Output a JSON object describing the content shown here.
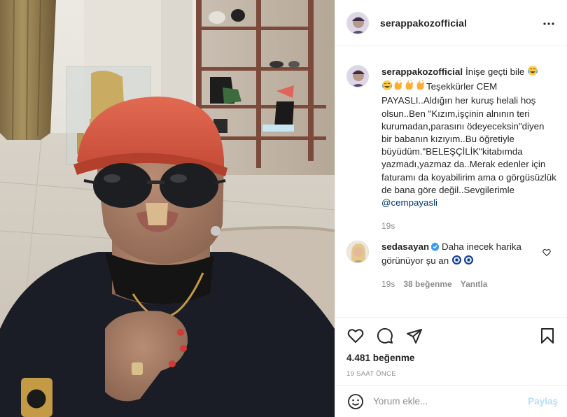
{
  "post": {
    "image_alt": "Selfie photo",
    "author": "serappakozofficial"
  },
  "header": {
    "username": "serappakozofficial",
    "more_icon": "more-horizontal-icon"
  },
  "caption": {
    "username": "serappakozofficial",
    "text_start": "İnişe geçti bile",
    "text_body": "Teşekkürler CEM PAYASLI..Aldığın her kuruş helali hoş olsun..Ben \"Kızım,işçinin alnının teri kurumadan,parasını ödeyeceksin\"diyen bir babanın kızıyım..Bu öğretiyle büyüdüm.\"BELEŞÇİLİK\"kitabımda yazmadı,yazmaz da..Merak edenler için faturamı da koyabilirim ama o görgüsüzlük de bana göre değil..Sevgilerimle",
    "mention": "@cempayasli",
    "time": "19s",
    "emojis": [
      "laughing-tears-emoji",
      "laughing-tears-emoji",
      "clapping-hands-emoji",
      "clapping-hands-emoji",
      "clapping-hands-emoji"
    ]
  },
  "reply": {
    "username": "sedasayan",
    "verified": true,
    "text": "Daha inecek harika görünüyor şu an",
    "emojis": [
      "evil-eye-emoji",
      "evil-eye-emoji"
    ],
    "time": "19s",
    "likes": "38 beğenme",
    "reply_label": "Yanıtla"
  },
  "actions": {
    "likes": "4.481 beğenme",
    "time_ago": "19 SAAT ÖNCE"
  },
  "comment_box": {
    "placeholder": "Yorum ekle...",
    "post_label": "Paylaş"
  },
  "colors": {
    "mention": "#00376b",
    "muted": "#8e8e8e",
    "post_disabled": "#b2dffc",
    "verified": "#3897f0"
  }
}
